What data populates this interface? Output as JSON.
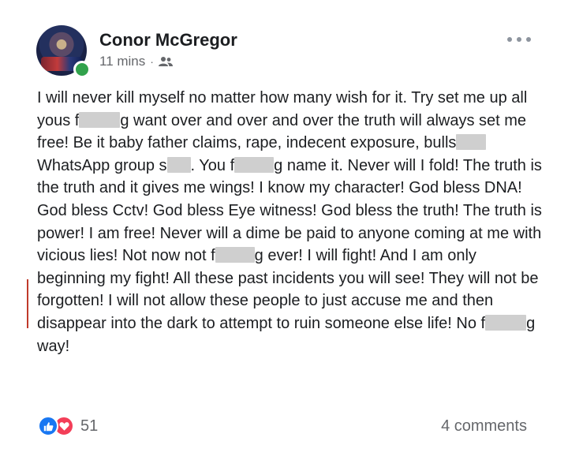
{
  "post": {
    "author": "Conor McGregor",
    "time": "11 mins",
    "separator": "·",
    "audience_icon": "friends-icon",
    "more_icon": "more-dots-icon"
  },
  "body_segments": [
    "I will never kill myself no matter how many wish for it. Try set me up all yous f",
    "g want over and over and over the truth will always set me free! Be it baby father claims, rape, indecent exposure, bulls",
    " WhatsApp group s",
    ". You f",
    "g name it. Never will I fold! The truth is the truth and it gives me wings! I know my character! God bless DNA! God bless Cctv! God bless Eye witness! God bless the truth! The truth is power! I am free! Never will a dime be paid to anyone coming at me with vicious lies! Not now not f",
    "g ever! I will fight! And I am only beginning my fight! All these past incidents you will see! They will not be forgotten! I will not allow these people to just accuse me and then disappear into the dark to attempt to ruin someone else life! No f",
    "g way!"
  ],
  "footer": {
    "reaction_icons": [
      "like-icon",
      "love-icon"
    ],
    "reaction_count": "51",
    "comments": "4 comments"
  },
  "colors": {
    "text": "#1c1e21",
    "secondary": "#65676b",
    "like": "#1877f2",
    "love": "#f33e58",
    "online": "#31a24c",
    "redaction": "#cfcfcf"
  }
}
